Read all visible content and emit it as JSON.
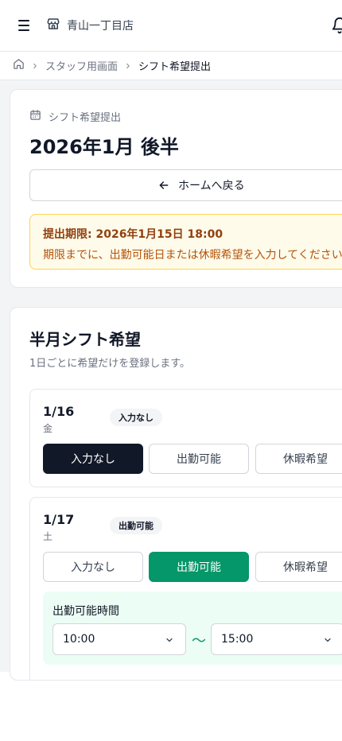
{
  "header": {
    "store_name": "青山一丁目店"
  },
  "breadcrumb": {
    "staff": "スタッフ用画面",
    "current": "シフト希望提出"
  },
  "request": {
    "section_label": "シフト希望提出",
    "period": "2026年1月 後半",
    "home_button": "ホームへ戻る",
    "deadline_title": "提出期限: 2026年1月15日 18:00",
    "deadline_text": "期限までに、出勤可能日または休暇希望を入力してください"
  },
  "half": {
    "title": "半月シフト希望",
    "subtitle": "1日ごとに希望だけを登録します。",
    "days": [
      {
        "date": "1/16",
        "weekday": "金",
        "status": "入力なし",
        "options": [
          "入力なし",
          "出勤可能",
          "休暇希望"
        ],
        "selected": "入力なし"
      },
      {
        "date": "1/17",
        "weekday": "土",
        "status": "出勤可能",
        "options": [
          "入力なし",
          "出勤可能",
          "休暇希望"
        ],
        "selected": "出勤可能",
        "availability": {
          "label": "出勤可能時間",
          "start": "10:00",
          "separator": "〜",
          "end": "15:00"
        }
      }
    ]
  },
  "colors": {
    "selected_dark": "#111827",
    "selected_green": "#059669",
    "deadline_bg": "#fffbeb",
    "deadline_title": "#92400e",
    "availability_bg": "#ecfdf5"
  },
  "icons": [
    "menu-icon",
    "store-icon",
    "bell-icon",
    "home-icon",
    "chevron-right-icon",
    "calendar-icon",
    "arrow-left-icon",
    "chevron-down-icon"
  ]
}
